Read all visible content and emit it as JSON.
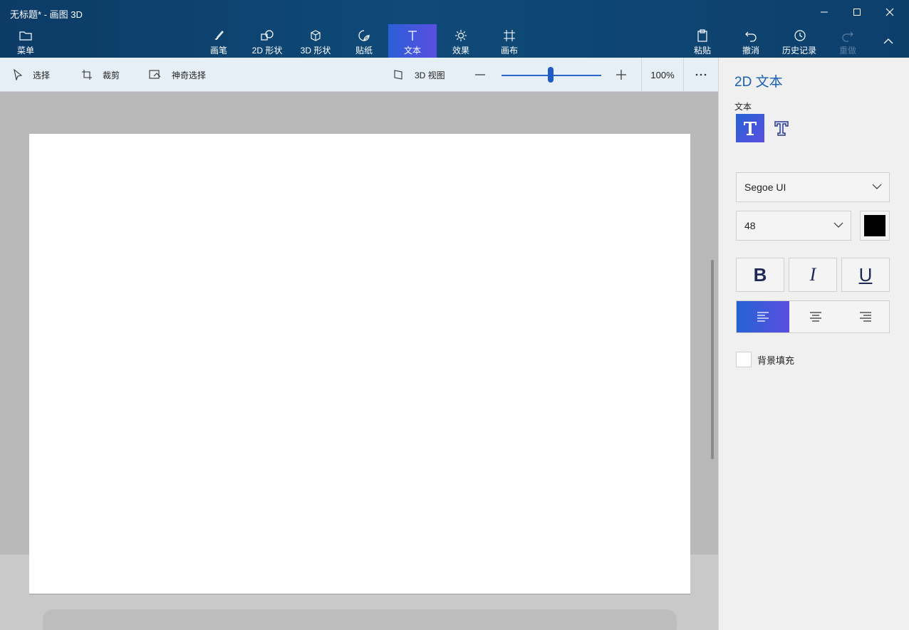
{
  "window": {
    "title": "无标题* - 画图 3D",
    "controls": [
      "minimize-icon",
      "maximize-icon",
      "close-icon"
    ]
  },
  "ribbon": {
    "menu": {
      "label": "菜单",
      "icon": "folder-icon"
    },
    "tools": [
      {
        "label": "画笔",
        "icon": "brush-icon"
      },
      {
        "label": "2D 形状",
        "icon": "2d-shapes-icon"
      },
      {
        "label": "3D 形状",
        "icon": "3d-shapes-icon"
      },
      {
        "label": "贴纸",
        "icon": "sticker-icon"
      },
      {
        "label": "文本",
        "icon": "text-icon",
        "active": true
      },
      {
        "label": "效果",
        "icon": "effects-icon"
      },
      {
        "label": "画布",
        "icon": "canvas-icon"
      }
    ],
    "right": [
      {
        "label": "粘贴",
        "icon": "paste-icon"
      },
      {
        "label": "撤消",
        "icon": "undo-icon"
      },
      {
        "label": "历史记录",
        "icon": "history-icon"
      },
      {
        "label": "重做",
        "icon": "redo-icon",
        "disabled": true
      }
    ],
    "collapse_icon": "chevron-up-icon"
  },
  "toolbar": {
    "select": "选择",
    "crop": "裁剪",
    "magic_select": "神奇选择",
    "view3d": "3D 视图",
    "zoom_value": 100,
    "zoom_label": "100%",
    "more_icon": "more-icon"
  },
  "panel": {
    "title": "2D 文本",
    "section_label": "文本",
    "font_family": "Segoe UI",
    "font_size": "48",
    "text_color": "#000000",
    "format": {
      "bold": "B",
      "italic": "I",
      "underline": "U"
    },
    "align_selected": "left",
    "background_fill_label": "背景填充",
    "background_fill_checked": false
  },
  "colors": {
    "accent": "#1a5fb4",
    "active_gradient_start": "#2463d4",
    "active_gradient_end": "#5b4ee0",
    "header": "#0f4a78"
  }
}
